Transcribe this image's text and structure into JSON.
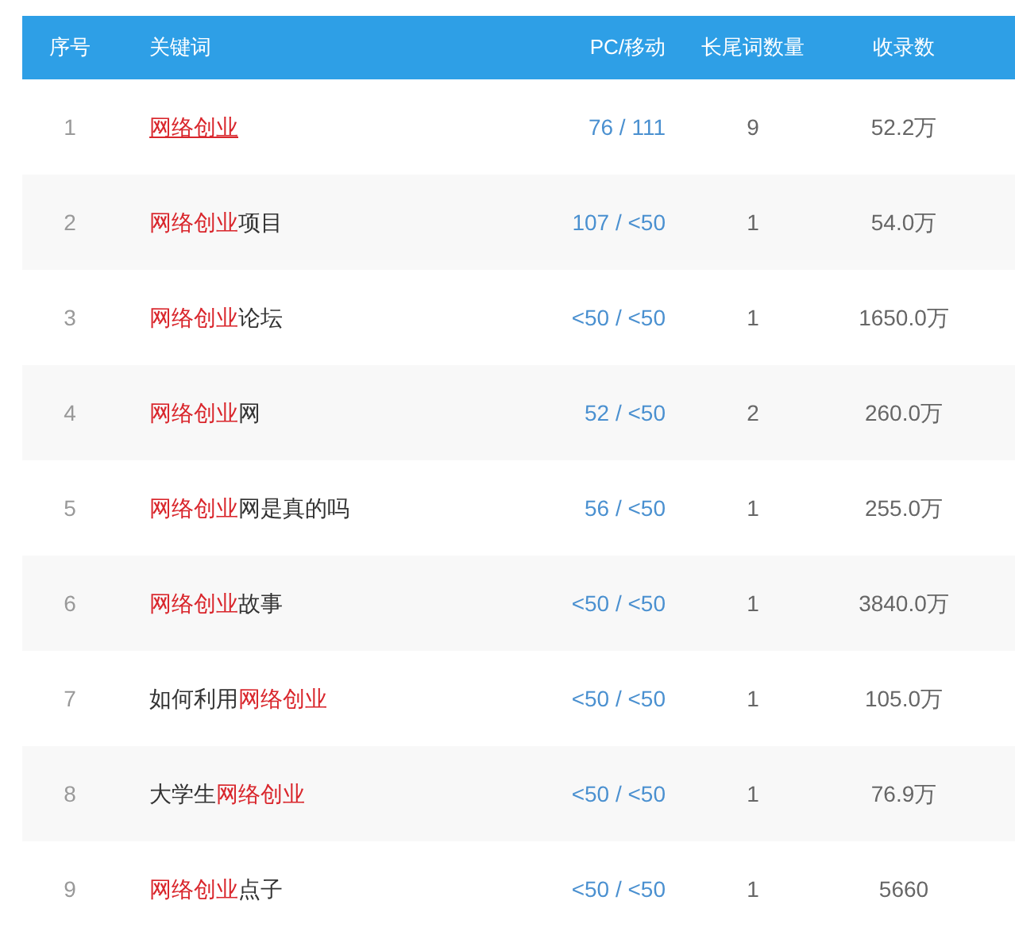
{
  "table": {
    "columns": [
      "序号",
      "关键词",
      "PC/移动",
      "长尾词数量",
      "收录数"
    ],
    "rows": [
      {
        "index": "1",
        "keyword": [
          {
            "text": "网络创业",
            "highlight": true
          }
        ],
        "underlined": true,
        "pc_mobile": "76 / 111",
        "long_tail": "9",
        "indexed": "52.2万"
      },
      {
        "index": "2",
        "keyword": [
          {
            "text": "网络创业",
            "highlight": true
          },
          {
            "text": "项目",
            "highlight": false
          }
        ],
        "underlined": false,
        "pc_mobile": "107 / <50",
        "long_tail": "1",
        "indexed": "54.0万"
      },
      {
        "index": "3",
        "keyword": [
          {
            "text": "网络创业",
            "highlight": true
          },
          {
            "text": "论坛",
            "highlight": false
          }
        ],
        "underlined": false,
        "pc_mobile": "<50 / <50",
        "long_tail": "1",
        "indexed": "1650.0万"
      },
      {
        "index": "4",
        "keyword": [
          {
            "text": "网络创业",
            "highlight": true
          },
          {
            "text": "网",
            "highlight": false
          }
        ],
        "underlined": false,
        "pc_mobile": "52 / <50",
        "long_tail": "2",
        "indexed": "260.0万"
      },
      {
        "index": "5",
        "keyword": [
          {
            "text": "网络创业",
            "highlight": true
          },
          {
            "text": "网是真的吗",
            "highlight": false
          }
        ],
        "underlined": false,
        "pc_mobile": "56 / <50",
        "long_tail": "1",
        "indexed": "255.0万"
      },
      {
        "index": "6",
        "keyword": [
          {
            "text": "网络创业",
            "highlight": true
          },
          {
            "text": "故事",
            "highlight": false
          }
        ],
        "underlined": false,
        "pc_mobile": "<50 / <50",
        "long_tail": "1",
        "indexed": "3840.0万"
      },
      {
        "index": "7",
        "keyword": [
          {
            "text": "如何利用",
            "highlight": false
          },
          {
            "text": "网络创业",
            "highlight": true
          }
        ],
        "underlined": false,
        "pc_mobile": "<50 / <50",
        "long_tail": "1",
        "indexed": "105.0万"
      },
      {
        "index": "8",
        "keyword": [
          {
            "text": "大学生",
            "highlight": false
          },
          {
            "text": "网络创业",
            "highlight": true
          }
        ],
        "underlined": false,
        "pc_mobile": "<50 / <50",
        "long_tail": "1",
        "indexed": "76.9万"
      },
      {
        "index": "9",
        "keyword": [
          {
            "text": "网络创业",
            "highlight": true
          },
          {
            "text": "点子",
            "highlight": false
          }
        ],
        "underlined": false,
        "pc_mobile": "<50 / <50",
        "long_tail": "1",
        "indexed": "5660"
      }
    ]
  }
}
